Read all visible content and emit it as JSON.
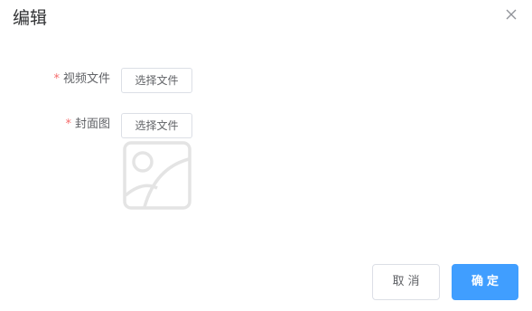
{
  "dialog": {
    "title": "编辑",
    "close_icon": "close-icon"
  },
  "form": {
    "video": {
      "required_mark": "*",
      "label": "视频文件",
      "button_label": "选择文件"
    },
    "cover": {
      "required_mark": "*",
      "label": "封面图",
      "button_label": "选择文件",
      "preview_icon": "image-placeholder-icon"
    }
  },
  "footer": {
    "cancel_label": "取消",
    "confirm_label": "确定"
  },
  "colors": {
    "primary": "#409eff",
    "required": "#f56c6c",
    "text": "#606266",
    "placeholder_icon": "#e6e6e6"
  }
}
